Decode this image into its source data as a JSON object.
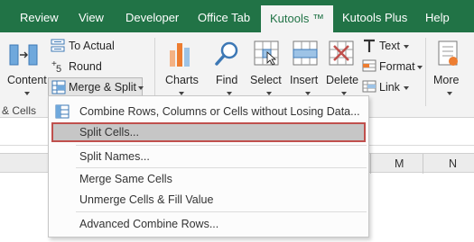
{
  "tabs": [
    "Review",
    "View",
    "Developer",
    "Office Tab",
    "Kutools ™",
    "Kutools Plus",
    "Help"
  ],
  "active_tab": "Kutools ™",
  "ribbon": {
    "content_label": "Content",
    "to_actual_label": "To Actual",
    "round_label": "Round",
    "merge_split_label": "Merge & Split",
    "group_cells_label": "& Cells",
    "charts_label": "Charts",
    "find_label": "Find",
    "select_label": "Select",
    "insert_label": "Insert",
    "delete_label": "Delete",
    "text_label": "Text",
    "format_label": "Format",
    "link_label": "Link",
    "more_label": "More"
  },
  "columns": [
    "M",
    "N"
  ],
  "menu": {
    "items": [
      "Combine Rows, Columns or Cells without Losing Data...",
      "Split Cells...",
      "Split Names...",
      "Merge Same Cells",
      "Unmerge Cells & Fill Value",
      "Advanced Combine Rows..."
    ],
    "highlighted": "Split Cells..."
  },
  "colors": {
    "tab_bar": "#217346",
    "ribbon_bg": "#f3f3f3",
    "highlight_border": "#c0504d",
    "highlight_fill": "#c6c6c6"
  }
}
